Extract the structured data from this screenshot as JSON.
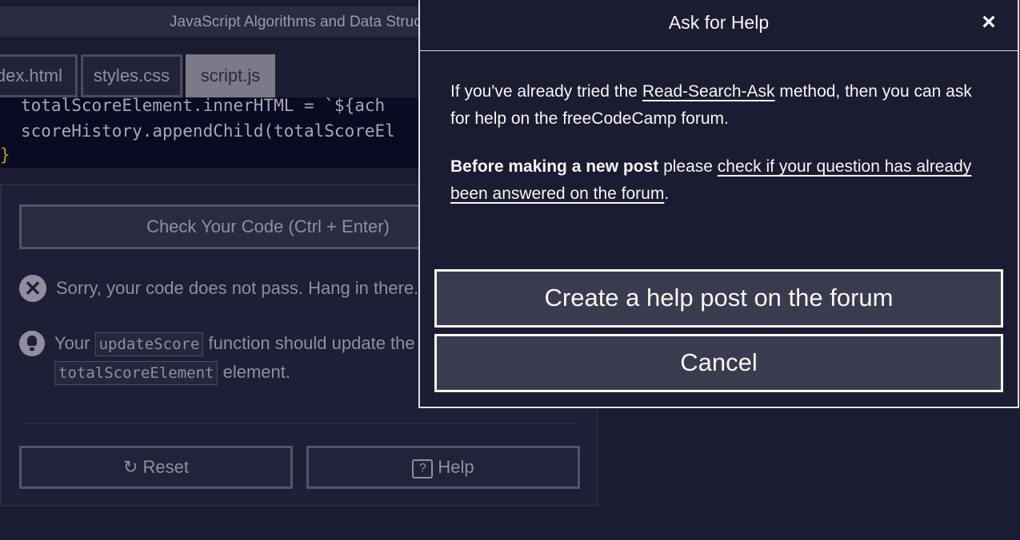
{
  "header": {
    "title": "JavaScript Algorithms and Data Structures"
  },
  "editor": {
    "tabs": [
      {
        "label": "index.html",
        "active": false
      },
      {
        "label": "styles.css",
        "active": false
      },
      {
        "label": "script.js",
        "active": true
      }
    ],
    "code_lines": [
      "totalScoreElement.innerHTML = `${ach",
      "scoreHistory.appendChild(totalScoreEl",
      "}"
    ]
  },
  "panel": {
    "check_button": "Check Your Code (Ctrl + Enter)",
    "fail_message": "Sorry, your code does not pass. Hang in there.",
    "hint_prefix": "Your",
    "hint_code1": "updateScore",
    "hint_middle": "function should update the",
    "hint_code2": "totalScoreElement",
    "hint_suffix": "element.",
    "reset_button": "Reset",
    "help_button": "Help"
  },
  "modal": {
    "title": "Ask for Help",
    "close_symbol": "×",
    "para1_before": "If you've already tried the ",
    "para1_link": "Read-Search-Ask",
    "para1_after": " method, then you can ask for help on the freeCodeCamp forum.",
    "para2_bold": "Before making a new post",
    "para2_text": " please ",
    "para2_link": "check if your question has already been answered on the forum",
    "para2_end": ".",
    "primary_button": "Create a help post on the forum",
    "cancel_button": "Cancel"
  },
  "colors": {
    "background": "#1b1b32",
    "modal_border": "#dfdfe2",
    "button_fill": "#3b3b4f",
    "text": "#f5f6f7"
  },
  "icons": {
    "close": "close-icon",
    "fail": "x-circle-icon",
    "hint": "lightbulb-icon",
    "reset": "reset-icon",
    "help": "question-icon"
  }
}
